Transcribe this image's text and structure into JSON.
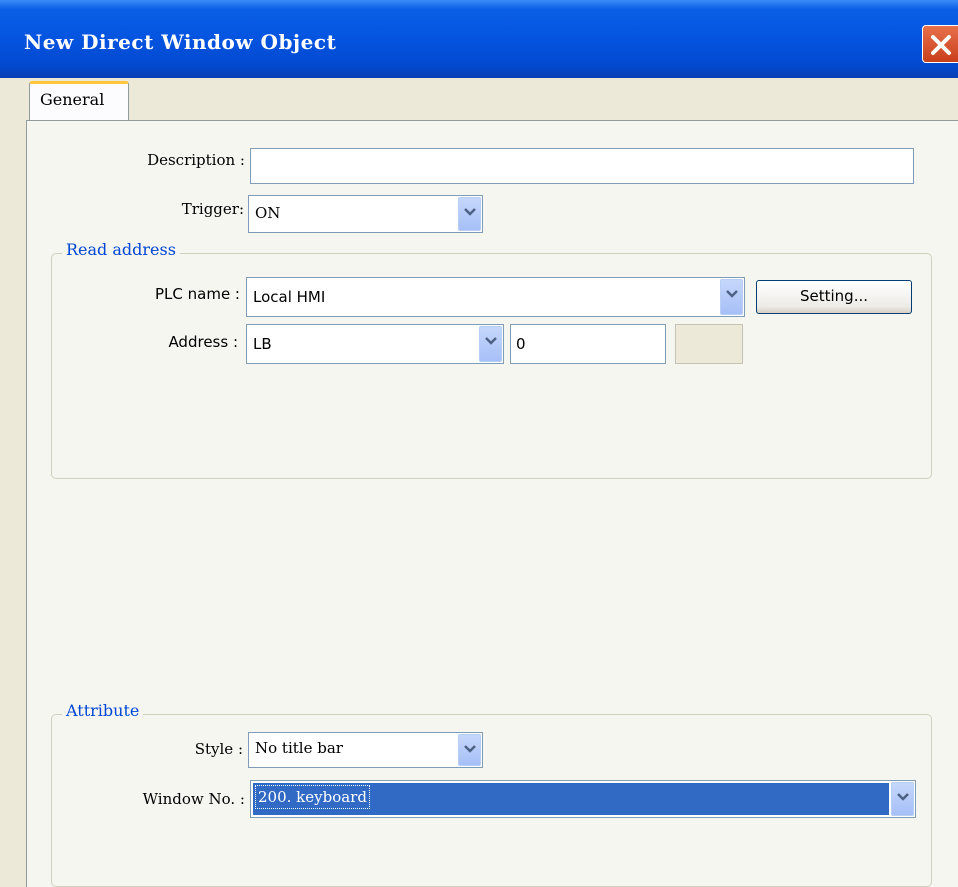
{
  "window": {
    "title": "New  Direct Window Object"
  },
  "tabs": [
    {
      "label": "General"
    }
  ],
  "form": {
    "description_label": "Description :",
    "description_value": "",
    "trigger_label": "Trigger:",
    "trigger_value": "ON"
  },
  "read_address": {
    "group_title": "Read address",
    "plc_label": "PLC name :",
    "plc_value": "Local HMI",
    "setting_button": "Setting...",
    "address_label": "Address :",
    "address_type": "LB",
    "address_value": "0",
    "address_extra": ""
  },
  "attribute": {
    "group_title": "Attribute",
    "style_label": "Style :",
    "style_value": "No title bar",
    "window_label": "Window No. :",
    "window_value": "200. keyboard"
  },
  "icons": {
    "close": "close-icon",
    "dropdown": "chevron-down-icon"
  },
  "colors": {
    "titlebar": "#0454e0",
    "group_title": "#0046d5",
    "selection": "#316ac5",
    "tab_accent": "#ffc83c"
  }
}
